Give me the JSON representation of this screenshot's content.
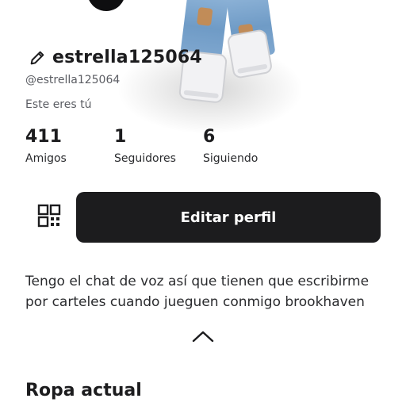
{
  "profile": {
    "display_name": "estrella125064",
    "username": "@estrella125064",
    "self_label": "Este eres tú"
  },
  "stats": {
    "friends": {
      "count": "411",
      "label": "Amigos"
    },
    "followers": {
      "count": "1",
      "label": "Seguidores"
    },
    "following": {
      "count": "6",
      "label": "Siguiendo"
    }
  },
  "actions": {
    "edit_profile_label": "Editar perfil",
    "qr_icon": "qr-code-icon"
  },
  "bio": {
    "text": "Tengo el chat de voz así que tienen que escribirme por carteles cuando jueguen conmigo brookhaven",
    "collapse_icon": "chevron-up-icon"
  },
  "sections": {
    "current_outfit_title": "Ropa actual"
  },
  "colors": {
    "background": "#ffffff",
    "primary_button": "#1c1c1e",
    "text": "#1c1c1e",
    "secondary_text": "#5b5d63"
  }
}
